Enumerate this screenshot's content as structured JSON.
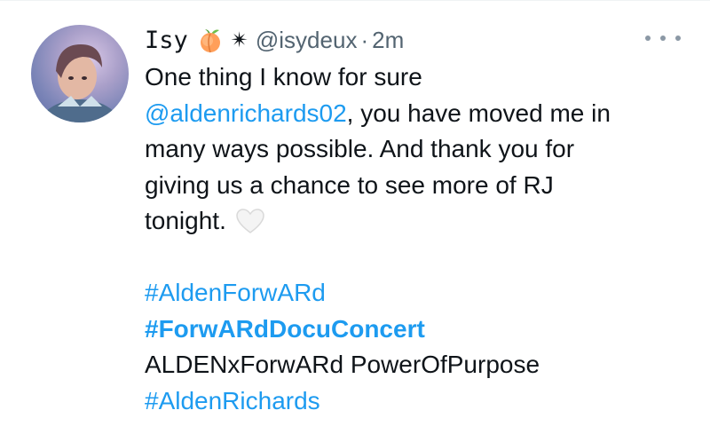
{
  "tweet": {
    "author_name": "Isy",
    "author_emoji_icon": "peach-icon",
    "author_symbol": "✴",
    "handle": "@isydeux",
    "separator": "·",
    "time": "2m",
    "more_icon": "more-dots-icon",
    "text": {
      "line1": "One thing I know for sure",
      "mention": "@aldenrichards02",
      "line2_rest": ", you have moved me in",
      "line3": "many ways possible. And thank you for",
      "line4": "giving us a chance to see more of RJ",
      "line5": "tonight.",
      "emoji_icon": "white-heart-icon"
    },
    "hashtags": {
      "tag1": "#AldenForwARd",
      "tag2": "#ForwARdDocuConcert",
      "plain_line": "ALDENxForwARd PowerOfPurpose",
      "tag3": "#AldenRichards"
    },
    "colors": {
      "link": "#1d9bf0",
      "secondary_text": "#536471",
      "primary_text": "#0f1419"
    }
  }
}
